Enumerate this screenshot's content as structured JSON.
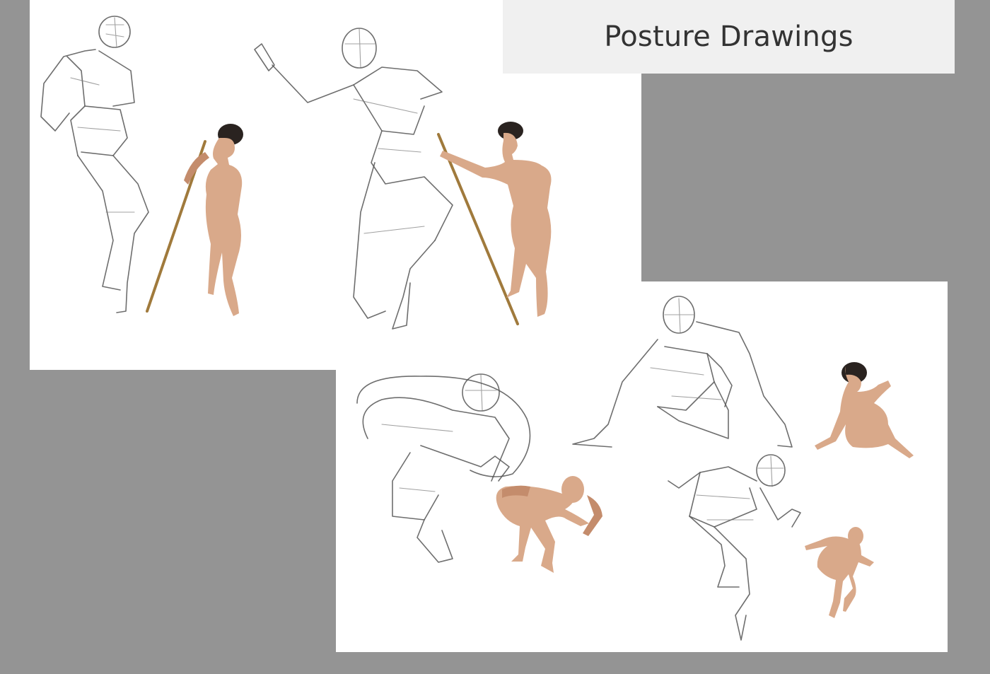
{
  "title": "Posture Drawings",
  "colors": {
    "background": "#949494",
    "sheet": "#ffffff",
    "title_box": "#f0f0f0",
    "title_text": "#333333"
  },
  "panels": [
    {
      "id": "standing-poses",
      "figures": [
        "sketch-woman-staff-1",
        "photo-woman-staff-1",
        "sketch-woman-staff-2",
        "photo-woman-staff-2"
      ]
    },
    {
      "id": "crouching-poses",
      "figures": [
        "sketch-man-crouch",
        "photo-man-crouch",
        "sketch-woman-seated",
        "photo-woman-seated",
        "sketch-man-lunge",
        "photo-man-lunge"
      ]
    }
  ]
}
